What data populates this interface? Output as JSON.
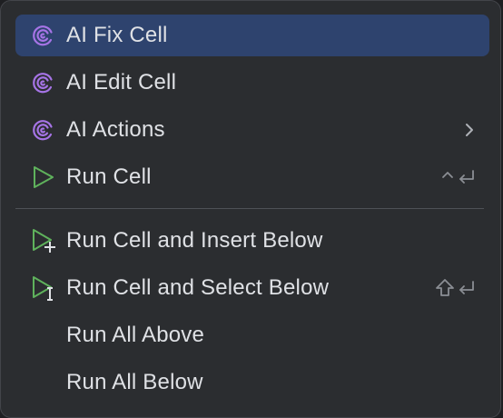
{
  "menu": {
    "items": [
      {
        "label": "AI Fix Cell",
        "icon": "ai-spiral-icon",
        "selected": true
      },
      {
        "label": "AI Edit Cell",
        "icon": "ai-spiral-icon"
      },
      {
        "label": "AI Actions",
        "icon": "ai-spiral-icon",
        "submenu": true
      },
      {
        "label": "Run Cell",
        "icon": "run-icon",
        "shortcut": "⌃⏎"
      },
      {
        "label": "Run Cell and Insert Below",
        "icon": "run-insert-icon"
      },
      {
        "label": "Run Cell and Select Below",
        "icon": "run-select-icon",
        "shortcut": "⇧⏎"
      },
      {
        "label": "Run All Above"
      },
      {
        "label": "Run All Below"
      }
    ]
  },
  "colors": {
    "background": "#2b2d30",
    "selected": "#2e436e",
    "text": "#dfe1e5",
    "ai_icon": "#a674e6",
    "run_icon": "#5fb25c",
    "shortcut": "#8b8e94"
  }
}
